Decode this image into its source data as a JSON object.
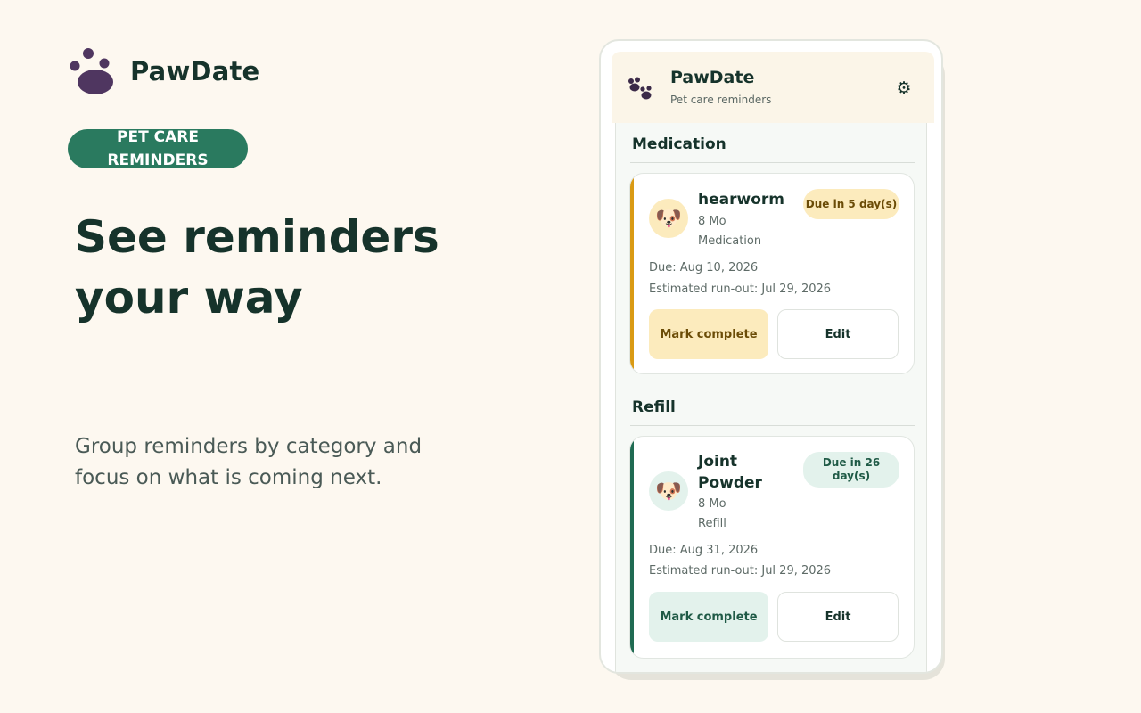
{
  "brand": {
    "name": "PawDate"
  },
  "pill": {
    "label": "PET CARE REMINDERS"
  },
  "headline": {
    "line1": "See reminders",
    "line2": "your way"
  },
  "subtext": "Group reminders by category and focus on what is coming next.",
  "app": {
    "title": "PawDate",
    "subtitle": "Pet care reminders",
    "settings_icon": "gear-icon"
  },
  "colors": {
    "brand_purple": "#4f3660",
    "pill_green": "#2a7a5f",
    "medication_accent": "#d99a14",
    "medication_badge_bg": "#fcebbd",
    "refill_accent": "#1f6b52",
    "refill_badge_bg": "#e3f2ec"
  },
  "sections": [
    {
      "title": "Medication",
      "card": {
        "pet_icon": "dog-face-icon",
        "name": "hearworm",
        "age": "8 Mo",
        "category": "Medication",
        "badge": "Due in 5 day(s)",
        "due": "Due: Aug 10, 2026",
        "runout": "Estimated run-out: Jul 29, 2026",
        "primary_action": "Mark complete",
        "secondary_action": "Edit"
      }
    },
    {
      "title": "Refill",
      "card": {
        "pet_icon": "dog-face-icon",
        "name": "Joint Powder",
        "age": "8 Mo",
        "category": "Refill",
        "badge": "Due in 26 day(s)",
        "due": "Due: Aug 31, 2026",
        "runout": "Estimated run-out: Jul 29, 2026",
        "primary_action": "Mark complete",
        "secondary_action": "Edit"
      }
    }
  ]
}
